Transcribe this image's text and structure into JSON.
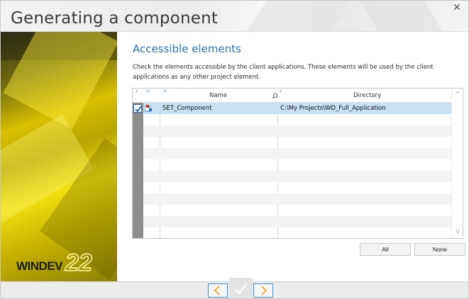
{
  "window": {
    "title": "Generating a component",
    "close_glyph": "✕"
  },
  "sidebar": {
    "logo_text": "WINDEV",
    "logo_version": "22"
  },
  "main": {
    "section_title": "Accessible elements",
    "description": "Check the elements accessible by the client applications. These elements will be used by the client applications as any other project element."
  },
  "table": {
    "columns": [
      {
        "label": "Name"
      },
      {
        "label": "Directory"
      }
    ],
    "rows": [
      {
        "checked": true,
        "icon": "component-icon",
        "name": "SET_Component",
        "directory": "C:\\My Projects\\WD_Full_Application"
      }
    ]
  },
  "buttons": {
    "all_label": "All",
    "none_label": "None"
  },
  "nav": {
    "prev_icon": "chevron-left-icon",
    "finish_icon": "checkmark-icon",
    "next_icon": "chevron-right-icon"
  },
  "colors": {
    "accent": "#2d6fa8",
    "selection": "#c9e1f4",
    "nav_chevron": "#f0a01e"
  }
}
